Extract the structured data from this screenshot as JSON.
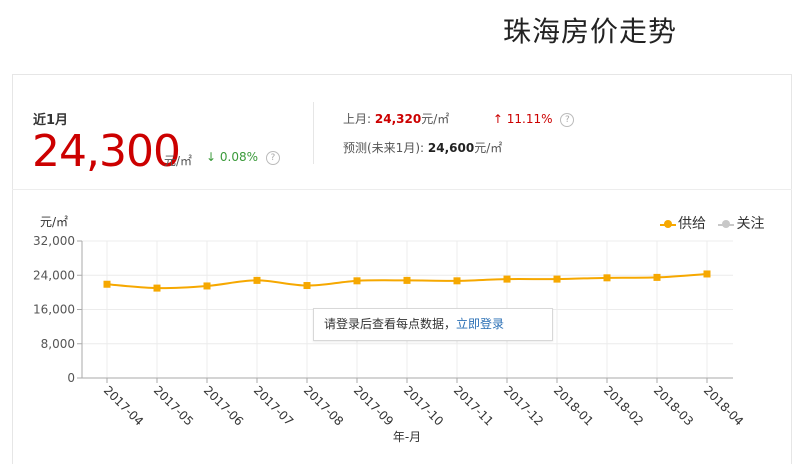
{
  "page": {
    "title": "珠海房价走势"
  },
  "summary": {
    "recent_label": "近1月",
    "recent_price": "24,300",
    "recent_unit": "元/㎡",
    "recent_change_arrow": "↓",
    "recent_change": "0.08%",
    "last_month_label": "上月:",
    "last_month_price": "24,320",
    "last_month_unit": "元/㎡",
    "last_month_change_arrow": "↑",
    "last_month_change": "11.11%",
    "forecast_label": "预测(未来1月):",
    "forecast_price": "24,600",
    "forecast_unit": "元/㎡",
    "help_glyph": "?"
  },
  "tooltip": {
    "text": "请登录后查看每点数据，",
    "link": "立即登录"
  },
  "colors": {
    "supply": "#f6a800",
    "attention": "#c8c8c8",
    "price_red": "#cc0000",
    "down_green": "#3a9a3a",
    "link": "#2a6fb5"
  },
  "chart_data": {
    "type": "line",
    "ylabel": "元/㎡",
    "xlabel": "年-月",
    "ylim": [
      0,
      32000
    ],
    "yticks": [
      "0",
      "8,000",
      "16,000",
      "24,000",
      "32,000"
    ],
    "categories": [
      "2017-04",
      "2017-05",
      "2017-06",
      "2017-07",
      "2017-08",
      "2017-09",
      "2017-10",
      "2017-11",
      "2017-12",
      "2018-01",
      "2018-02",
      "2018-03",
      "2018-04"
    ],
    "series": [
      {
        "name": "供给",
        "color": "#f6a800",
        "values": [
          21900,
          21000,
          21500,
          22800,
          21600,
          22700,
          22800,
          22700,
          23100,
          23100,
          23400,
          23500,
          24300
        ]
      }
    ],
    "legend": [
      {
        "label": "供给",
        "color": "#f6a800"
      },
      {
        "label": "关注",
        "color": "#c8c8c8"
      }
    ],
    "legend_position": "top-right",
    "grid": true
  }
}
